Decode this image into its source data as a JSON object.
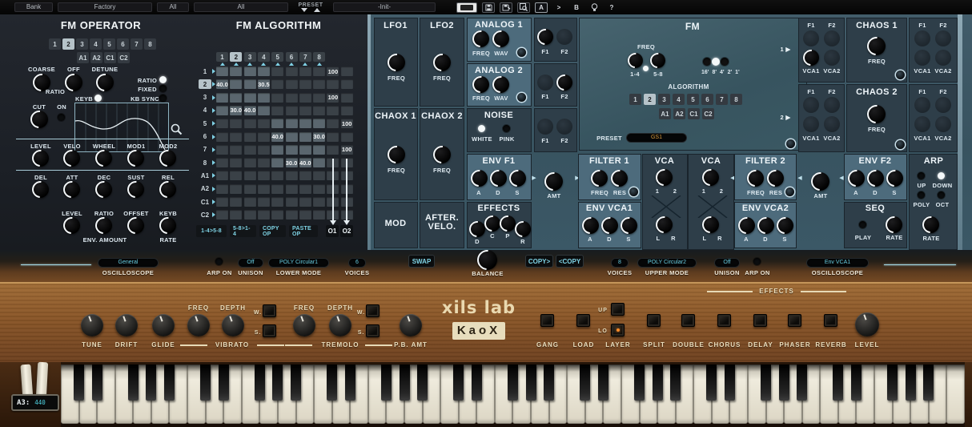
{
  "toolbar": {
    "bank": "Bank",
    "bank_value": "Factory",
    "filter_all_1": "All",
    "filter_all_2": "All",
    "preset_label": "PRESET",
    "preset_value": "-Init-",
    "ab_a": "A",
    "ab_copy": ">",
    "ab_b": "B",
    "help": "?"
  },
  "fm_operator": {
    "title": "FM OPERATOR",
    "ops": [
      "1",
      "2",
      "3",
      "4",
      "5",
      "6",
      "7",
      "8"
    ],
    "selected_op": "2",
    "ops2": [
      "A1",
      "A2",
      "C1",
      "C2"
    ],
    "coarse": "COARSE",
    "off": "OFF",
    "detune": "DETUNE",
    "ratio_sub": "RATIO",
    "ratio": "RATIO",
    "fixed": "FIXED",
    "keyb": "KEYB",
    "kb_sync": "KB SYNC",
    "cut": "CUT",
    "on": "ON",
    "mod_labels": [
      "LEVEL",
      "VELO",
      "WHEEL",
      "MOD1",
      "MOD2"
    ],
    "env_labels": [
      "DEL",
      "ATT",
      "DEC",
      "SUST",
      "REL"
    ],
    "amt_labels": [
      "LEVEL",
      "RATIO",
      "OFFSET",
      "KEYB"
    ],
    "env_amount": "ENV. AMOUNT",
    "rate": "RATE"
  },
  "fm_algorithm": {
    "title": "FM ALGORITHM",
    "cols": [
      "1",
      "2",
      "3",
      "4",
      "5",
      "6",
      "7",
      "8"
    ],
    "selected_col": "2",
    "row_labels": [
      "1",
      "2",
      "3",
      "4",
      "5",
      "6",
      "7",
      "8",
      "A1",
      "A2",
      "C1",
      "C2"
    ],
    "selected_row": "2",
    "matrix": [
      [
        "",
        "",
        "",
        "",
        "",
        "",
        "",
        "",
        "100",
        ""
      ],
      [
        "40.0",
        "",
        "",
        "30.5",
        "",
        "",
        "",
        "",
        "",
        ""
      ],
      [
        "",
        "",
        "",
        "",
        "",
        "",
        "",
        "",
        "100",
        ""
      ],
      [
        "",
        "30.0",
        "40.0",
        "",
        "",
        "",
        "",
        "",
        "",
        ""
      ],
      [
        "",
        "",
        "",
        "",
        "",
        "",
        "",
        "",
        "",
        "100"
      ],
      [
        "",
        "",
        "",
        "",
        "40.0",
        "",
        "",
        "30.0",
        "",
        ""
      ],
      [
        "",
        "",
        "",
        "",
        "",
        "",
        "",
        "",
        "",
        "100"
      ],
      [
        "",
        "",
        "",
        "",
        "",
        "30.0",
        "40.0",
        "",
        "",
        ""
      ],
      [
        "",
        "",
        "",
        "",
        "",
        "",
        "",
        "",
        "",
        ""
      ],
      [
        "",
        "",
        "",
        "",
        "",
        "",
        "",
        "",
        "",
        ""
      ],
      [
        "",
        "",
        "",
        "",
        "",
        "",
        "",
        "",
        "",
        ""
      ],
      [
        "",
        "",
        "",
        "",
        "",
        "",
        "",
        "",
        "",
        ""
      ]
    ],
    "buttons": [
      "1-4>5-8",
      "5-8>1-4",
      "COPY OP",
      "PASTE OP"
    ],
    "out1": "O1",
    "out2": "O2"
  },
  "fm_panel": {
    "title": "FM",
    "freq_label": "FREQ",
    "knob_14": "1-4",
    "knob_58": "5-8",
    "octave_labels": [
      "16'",
      "8'",
      "4'",
      "2'",
      "1'"
    ],
    "algorithm_label": "ALGORITHM",
    "algo_buttons": [
      "1",
      "2",
      "3",
      "4",
      "5",
      "6",
      "7",
      "8"
    ],
    "selected": "2",
    "algo_buttons2": [
      "A1",
      "A2",
      "C1",
      "C2"
    ],
    "preset_label": "PRESET",
    "preset_value": "GS1",
    "marker1": "1",
    "marker2": "2"
  },
  "modules": {
    "lfo1": {
      "title": "LFO1",
      "freq": "FREQ"
    },
    "lfo2": {
      "title": "LFO2",
      "freq": "FREQ"
    },
    "analog1": {
      "title": "ANALOG 1",
      "freq": "FREQ",
      "wav": "WAV"
    },
    "analog2": {
      "title": "ANALOG 2",
      "freq": "FREQ",
      "wav": "WAV"
    },
    "chaox1": {
      "title": "CHAOX 1",
      "freq": "FREQ"
    },
    "chaox2": {
      "title": "CHAOX 2",
      "freq": "FREQ"
    },
    "noise": {
      "title": "NOISE",
      "white": "WHITE",
      "pink": "PINK"
    },
    "f1f2": {
      "f1": "F1",
      "f2": "F2"
    },
    "env_f1": {
      "title": "ENV F1",
      "a": "A",
      "d": "D",
      "s": "S"
    },
    "amt1": "AMT",
    "filter1": {
      "title": "FILTER 1",
      "freq": "FREQ",
      "res": "RES"
    },
    "vca": {
      "title": "VCA",
      "one": "1",
      "two": "2",
      "l": "L",
      "r": "R"
    },
    "filter2": {
      "title": "FILTER 2",
      "freq": "FREQ",
      "res": "RES"
    },
    "amt2": "AMT",
    "env_f2": {
      "title": "ENV F2",
      "a": "A",
      "d": "D",
      "s": "S"
    },
    "mod_label": "MOD",
    "after_velo_1": "AFTER.",
    "after_velo_2": "VELO.",
    "effects": {
      "title": "EFFECTS",
      "d": "D",
      "c": "C",
      "p": "P",
      "r": "R"
    },
    "env_vca1": {
      "title": "ENV VCA1",
      "a": "A",
      "d": "D",
      "s": "S"
    },
    "env_vca2": {
      "title": "ENV VCA2",
      "a": "A",
      "d": "D",
      "s": "S"
    },
    "seq": {
      "title": "SEQ",
      "play": "PLAY",
      "rate": "RATE"
    },
    "arp": {
      "title": "ARP",
      "up": "UP",
      "down": "DOWN",
      "poly": "POLY",
      "oct": "OCT",
      "rate": "RATE"
    }
  },
  "chaos1": {
    "title": "CHAOS 1",
    "freq": "FREQ"
  },
  "chaos2": {
    "title": "CHAOS 2",
    "freq": "FREQ"
  },
  "grid_labels": {
    "f1": "F1",
    "f2": "F2",
    "vca1": "VCA1",
    "vca2": "VCA2"
  },
  "bottom": {
    "oscilloscope_label_left": "OSCILLOSCOPE",
    "osc_left_value": "General",
    "arp_on_left": "ARP ON",
    "unison_left": "UNISON",
    "unison_left_value": "Off",
    "lower_mode_label": "LOWER MODE",
    "lower_mode_value": "POLY Circular1",
    "voices_label_left": "VOICES",
    "voices_left_value": "6",
    "swap": "SWAP",
    "balance": "BALANCE",
    "copy_right": "COPY>",
    "copy_left": "<COPY",
    "voices_label_right": "VOICES",
    "voices_right_value": "8",
    "upper_mode_label": "UPPER MODE",
    "upper_mode_value": "POLY Circular2",
    "unison_right": "UNISON",
    "unison_right_value": "Off",
    "arp_on_right": "ARP ON",
    "oscilloscope_label_right": "OSCILLOSCOPE",
    "osc_right_value": "Env VCA1"
  },
  "wood": {
    "tune": "TUNE",
    "drift": "DRIFT",
    "glide": "GLIDE",
    "vibrato": "VIBRATO",
    "tremolo": "TREMOLO",
    "freq": "FREQ",
    "depth": "DEPTH",
    "w": "W.",
    "s": "S.",
    "pb_amt": "P.B. AMT",
    "logo_top": "xils lab",
    "logo_main": "KaoX",
    "gang": "GANG",
    "load": "LOAD",
    "layer": "LAYER",
    "up": "UP",
    "lo": "LO",
    "split": "SPLIT",
    "double": "DOUBLE",
    "chorus": "CHORUS",
    "delay": "DELAY",
    "phaser": "PHASER",
    "reverb": "REVERB",
    "effects": "EFFECTS",
    "level": "LEVEL"
  },
  "keyboard": {
    "note": "A3:",
    "freq": "440",
    "white_key_count": 50
  }
}
